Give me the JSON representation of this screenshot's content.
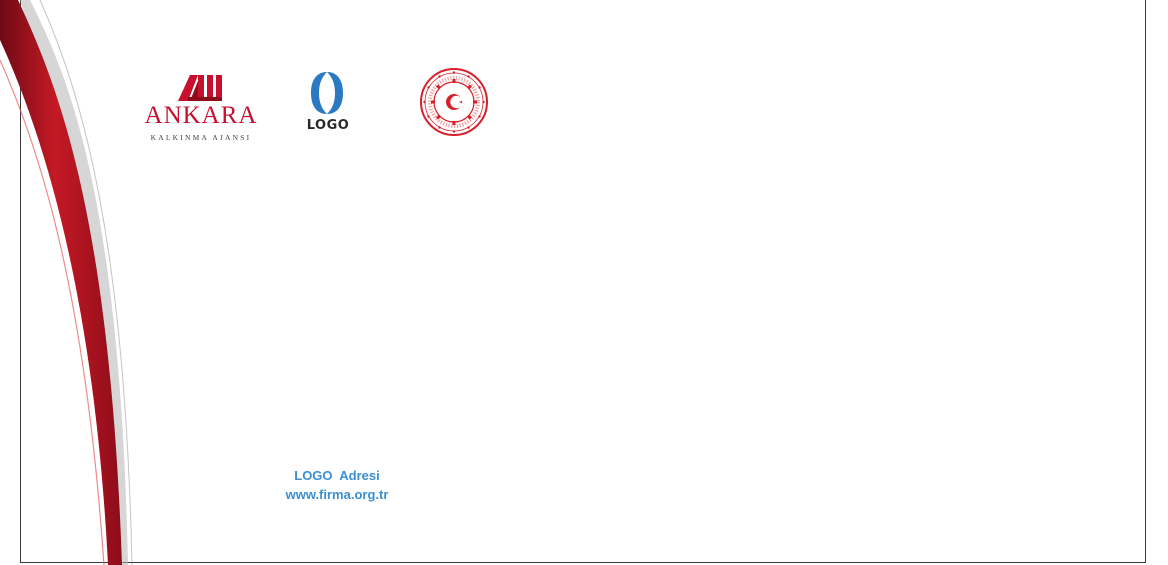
{
  "envelope": {
    "colors": {
      "accent_red": "#c8102e",
      "dark_red": "#8e0c1a",
      "link_blue": "#3a8fd4",
      "logo_blue": "#2b79c2",
      "frame": "#3a3a3a"
    }
  },
  "logos": {
    "ankara": {
      "name": "ANKARA",
      "subtitle": "KALKINMA AJANSI"
    },
    "logo": {
      "name": "LOGO"
    },
    "seal": {
      "icon": "ministry-seal-icon"
    }
  },
  "address": {
    "line1": "LOGO  Adresi",
    "line2": "www.firma.org.tr"
  }
}
